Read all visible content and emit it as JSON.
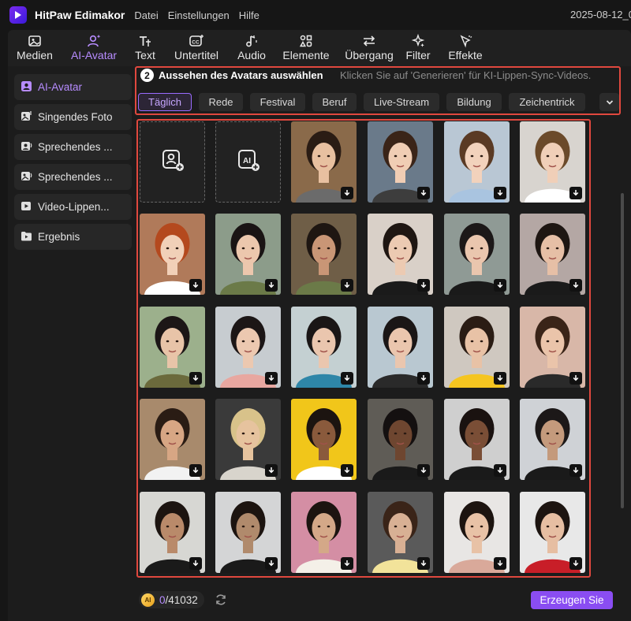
{
  "titlebar": {
    "app_name": "HitPaw Edimakor",
    "menu": [
      "Datei",
      "Einstellungen",
      "Hilfe"
    ],
    "date": "2025-08-12_0"
  },
  "toolbar": {
    "tabs": [
      {
        "label": "Medien",
        "icon": "media-icon"
      },
      {
        "label": "AI-Avatar",
        "icon": "ai-avatar-icon",
        "active": true
      },
      {
        "label": "Text",
        "icon": "text-icon"
      },
      {
        "label": "Untertitel",
        "icon": "subtitle-icon"
      },
      {
        "label": "Audio",
        "icon": "audio-icon"
      },
      {
        "label": "Elemente",
        "icon": "elements-icon"
      },
      {
        "label": "Übergang",
        "icon": "transition-icon"
      },
      {
        "label": "Filter",
        "icon": "filter-icon"
      },
      {
        "label": "Effekte",
        "icon": "effects-icon"
      }
    ]
  },
  "sidebar": {
    "items": [
      {
        "label": "AI-Avatar",
        "icon": "avatar-icon",
        "active": true
      },
      {
        "label": "Singendes Foto",
        "icon": "singing-photo-icon"
      },
      {
        "label": "Sprechendes ...",
        "icon": "talking-icon"
      },
      {
        "label": "Sprechendes ...",
        "icon": "talking-photo-icon"
      },
      {
        "label": "Video-Lippen...",
        "icon": "video-lipsync-icon"
      },
      {
        "label": "Ergebnis",
        "icon": "result-icon"
      }
    ]
  },
  "panel": {
    "step": "2",
    "title": "Aussehen des Avatars auswählen",
    "hint": "Klicken Sie auf 'Generieren' für KI-Lippen-Sync-Videos.",
    "categories": [
      {
        "label": "Täglich",
        "active": true
      },
      {
        "label": "Rede"
      },
      {
        "label": "Festival"
      },
      {
        "label": "Beruf"
      },
      {
        "label": "Live-Stream"
      },
      {
        "label": "Bildung"
      },
      {
        "label": "Zeichentrick"
      }
    ]
  },
  "avatars": {
    "upload_tiles": [
      "upload-photo-icon",
      "ai-generate-avatar-icon"
    ],
    "colors": {
      "accent": "#9a6bff",
      "highlight": "#e0483e"
    }
  },
  "footer": {
    "coin_label": "AI",
    "credits_used": "0",
    "credits_total": "/41032",
    "generate_label": "Erzeugen Sie"
  }
}
